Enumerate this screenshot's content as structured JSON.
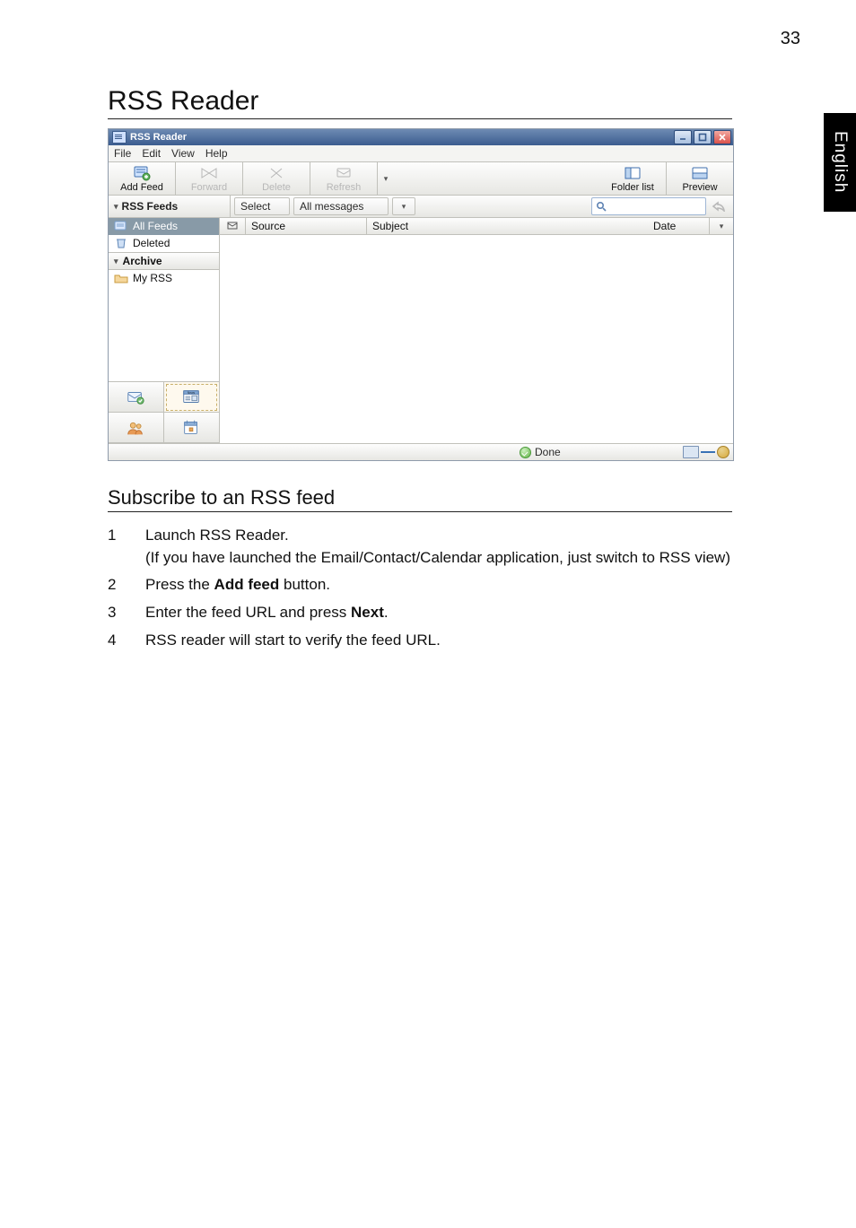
{
  "page_number": "33",
  "side_tab": "English",
  "heading": "RSS Reader",
  "window": {
    "title": "RSS Reader",
    "menus": [
      "File",
      "Edit",
      "View",
      "Help"
    ],
    "toolbar": {
      "add_feed": "Add Feed",
      "forward": "Forward",
      "delete": "Delete",
      "refresh": "Refresh",
      "folder_list": "Folder list",
      "preview": "Preview"
    },
    "filter": {
      "left_label": "RSS Feeds",
      "select_label": "Select",
      "dropdown_label": "All messages"
    },
    "tree": {
      "all_feeds": "All Feeds",
      "deleted": "Deleted",
      "archive_section": "Archive",
      "my_rss": "My RSS"
    },
    "list_headers": {
      "source": "Source",
      "subject": "Subject",
      "date": "Date"
    },
    "status": {
      "done": "Done"
    }
  },
  "sub_heading": "Subscribe to an RSS feed",
  "steps": [
    {
      "n": "1",
      "text_a": "Launch RSS Reader.",
      "text_b": "(If you have launched the Email/Contact/Calendar application, just switch to RSS view)"
    },
    {
      "n": "2",
      "text_a": "Press the ",
      "bold": "Add feed",
      "text_b": " button."
    },
    {
      "n": "3",
      "text_a": "Enter the feed URL and press ",
      "bold": "Next",
      "text_b": "."
    },
    {
      "n": "4",
      "text_a": "RSS reader will start to verify the feed URL.",
      "text_b": ""
    }
  ]
}
